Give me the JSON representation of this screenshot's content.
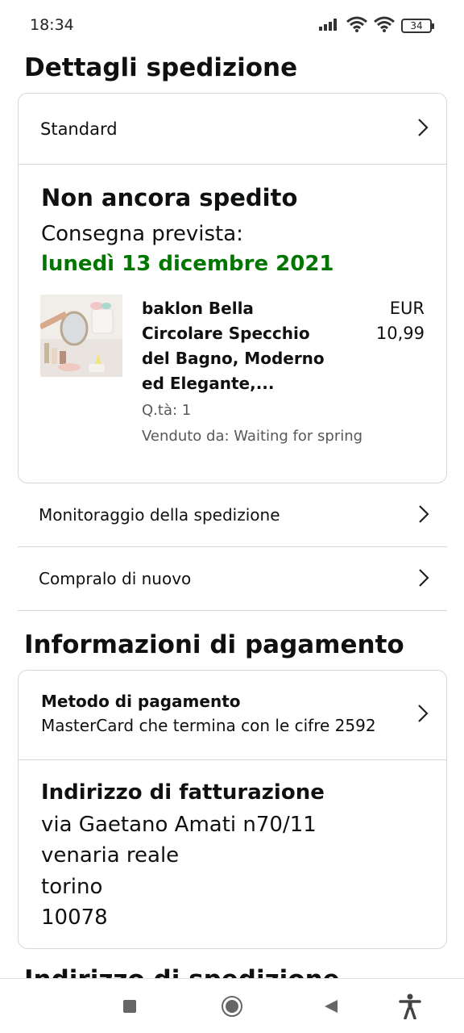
{
  "status_bar": {
    "time": "18:34",
    "battery": "34",
    "icons": [
      "signal-icon",
      "wifi-icon",
      "wifi-icon",
      "battery-icon"
    ]
  },
  "shipping_section": {
    "title": "Dettagli spedizione",
    "method": "Standard",
    "status": "Non ancora spedito",
    "delivery_label": "Consegna prevista:",
    "delivery_date": "lunedì 13 dicembre 2021",
    "delivery_date_color": "#007600",
    "product": {
      "name_lines": [
        "baklon Bella",
        "Circolare Specchio",
        "del Bagno, Moderno",
        "ed Elegante,..."
      ],
      "price_currency": "EUR",
      "price_value": "10,99",
      "quantity": "Q.tà: 1",
      "seller": "Venduto da: Waiting for spring"
    },
    "track_label": "Monitoraggio della spedizione",
    "buy_again_label": "Compralo di nuovo"
  },
  "payment_section": {
    "title": "Informazioni di pagamento",
    "method_title": "Metodo di pagamento",
    "method_value": "MasterCard che termina con le cifre 2592",
    "billing_title": "Indirizzo di fatturazione",
    "billing_lines": [
      "via Gaetano Amati n70/11",
      "venaria reale",
      "torino",
      "10078"
    ]
  },
  "next_section_title_cut": "Indirizzo di spedizione",
  "nav_bar": {
    "icons": [
      "recents-icon",
      "home-icon",
      "back-icon",
      "accessibility-icon"
    ]
  }
}
